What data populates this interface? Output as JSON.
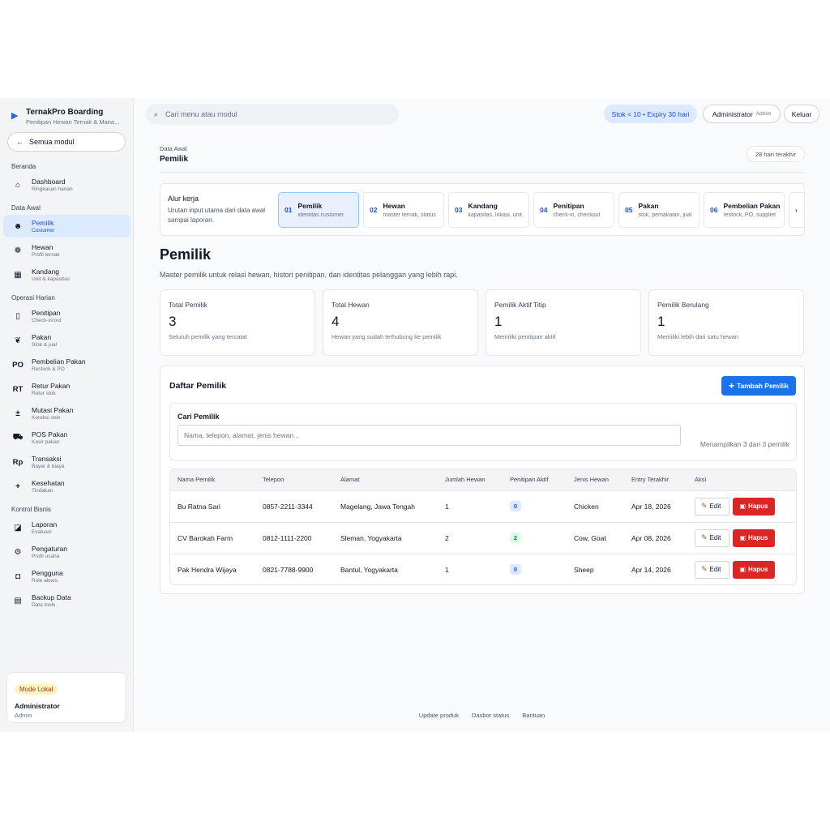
{
  "brand": {
    "title": "TernakPro Boarding",
    "subtitle": "Penitipan Hewan Ternak & Mana..."
  },
  "sidebar": {
    "all_modules": "Semua modul",
    "sections": [
      {
        "label": "Beranda",
        "items": [
          {
            "icon": "house-icon",
            "glyph": "⌂",
            "label": "Dashboard",
            "sub": "Ringkasan harian"
          }
        ]
      },
      {
        "label": "Data Awal",
        "items": [
          {
            "icon": "person-icon",
            "glyph": "☻",
            "label": "Pemilik",
            "sub": "Customer",
            "active": true
          },
          {
            "icon": "paw-icon",
            "glyph": "❁",
            "label": "Hewan",
            "sub": "Profil ternak"
          },
          {
            "icon": "barn-icon",
            "glyph": "▦",
            "label": "Kandang",
            "sub": "Unit & kapasitas"
          }
        ]
      },
      {
        "label": "Operasi Harian",
        "items": [
          {
            "icon": "clipboard-icon",
            "glyph": "▯",
            "label": "Penitipan",
            "sub": "Check-in/out"
          },
          {
            "icon": "feed-icon",
            "glyph": "❦",
            "label": "Pakan",
            "sub": "Stok & jual"
          },
          {
            "icon": "po-icon",
            "glyph": "PO",
            "label": "Pembelian Pakan",
            "sub": "Restock & PO"
          },
          {
            "icon": "rt-icon",
            "glyph": "RT",
            "label": "Retur Pakan",
            "sub": "Retur stok"
          },
          {
            "icon": "plus-minus-icon",
            "glyph": "±",
            "label": "Mutasi Pakan",
            "sub": "Koreksi stok"
          },
          {
            "icon": "cart-icon",
            "glyph": "⛟",
            "label": "POS Pakan",
            "sub": "Kasir pakan"
          },
          {
            "icon": "rupiah-icon",
            "glyph": "Rp",
            "label": "Transaksi",
            "sub": "Bayar & biaya"
          },
          {
            "icon": "health-icon",
            "glyph": "+",
            "label": "Kesehatan",
            "sub": "Tindakan"
          }
        ]
      },
      {
        "label": "Kontrol Bisnis",
        "items": [
          {
            "icon": "chart-icon",
            "glyph": "◪",
            "label": "Laporan",
            "sub": "Evaluasi"
          },
          {
            "icon": "gear-icon",
            "glyph": "⚙",
            "label": "Pengaturan",
            "sub": "Profil usaha"
          },
          {
            "icon": "lock-icon",
            "glyph": "◘",
            "label": "Pengguna",
            "sub": "Role akses"
          },
          {
            "icon": "database-icon",
            "glyph": "▤",
            "label": "Backup Data",
            "sub": "Data tools"
          }
        ]
      }
    ],
    "mode_badge": "Mode Lokal",
    "user_name": "Administrator",
    "user_role": "Admin"
  },
  "topbar": {
    "search_placeholder": "Cari menu atau modul",
    "stock_alert": "Stok < 10 • Expiry 30 hari",
    "admin_name": "Administrator",
    "admin_role": "Admin",
    "logout": "Keluar"
  },
  "header": {
    "breadcrumb": "Data Awal",
    "title": "Pemilik",
    "range": "28 hari terakhir"
  },
  "workflow": {
    "title": "Alur kerja",
    "desc": "Urutan input utama dari data awal sampai laporan.",
    "steps": [
      {
        "num": "01",
        "name": "Pemilik",
        "sub": "identitas customer",
        "active": true
      },
      {
        "num": "02",
        "name": "Hewan",
        "sub": "master ternak, status"
      },
      {
        "num": "03",
        "name": "Kandang",
        "sub": "kapasitas, lokasi, unit"
      },
      {
        "num": "04",
        "name": "Penitipan",
        "sub": "check-in, checkout"
      },
      {
        "num": "05",
        "name": "Pakan",
        "sub": "stok, pemakaian, jual"
      },
      {
        "num": "06",
        "name": "Pembelian Pakan",
        "sub": "restock, PO, supplier"
      }
    ]
  },
  "page": {
    "title": "Pemilik",
    "desc": "Master pemilik untuk relasi hewan, histori penitipan, dan identitas pelanggan yang lebih rapi."
  },
  "stats": [
    {
      "label": "Total Pemilik",
      "value": "3",
      "desc": "Seluruh pemilik yang tercatat"
    },
    {
      "label": "Total Hewan",
      "value": "4",
      "desc": "Hewan yang sudah terhubung ke pemilik"
    },
    {
      "label": "Pemilik Aktif Titip",
      "value": "1",
      "desc": "Memiliki penitipan aktif"
    },
    {
      "label": "Pemilik Berulang",
      "value": "1",
      "desc": "Memiliki lebih dari satu hewan"
    }
  ],
  "list": {
    "title": "Daftar Pemilik",
    "add_label": "Tambah Pemilik",
    "filter_label": "Cari Pemilik",
    "filter_placeholder": "Nama, telepon, alamat, jenis hewan...",
    "count_text": "Menampilkan 3 dari 3 pemilik",
    "columns": [
      "Nama Pemilik",
      "Telepon",
      "Alamat",
      "Jumlah Hewan",
      "Penitipan Aktif",
      "Jenis Hewan",
      "Entry Terakhir",
      "Aksi"
    ],
    "edit_label": "Edit",
    "delete_label": "Hapus",
    "rows": [
      {
        "name": "Bu Ratna Sari",
        "phone": "0857-2211-3344",
        "address": "Magelang, Jawa Tengah",
        "animals": "1",
        "active": "0",
        "active_color": "blue",
        "type": "Chicken",
        "last": "Apr 18, 2026"
      },
      {
        "name": "CV Barokah Farm",
        "phone": "0812-1111-2200",
        "address": "Sleman, Yogyakarta",
        "animals": "2",
        "active": "2",
        "active_color": "green",
        "type": "Cow, Goat",
        "last": "Apr 08, 2026"
      },
      {
        "name": "Pak Hendra Wijaya",
        "phone": "0821-7788-9900",
        "address": "Bantul, Yogyakarta",
        "animals": "1",
        "active": "0",
        "active_color": "blue",
        "type": "Sheep",
        "last": "Apr 14, 2026"
      }
    ]
  },
  "footer": {
    "links": [
      "Update produk",
      "Dasbor status",
      "Bantuan"
    ]
  }
}
